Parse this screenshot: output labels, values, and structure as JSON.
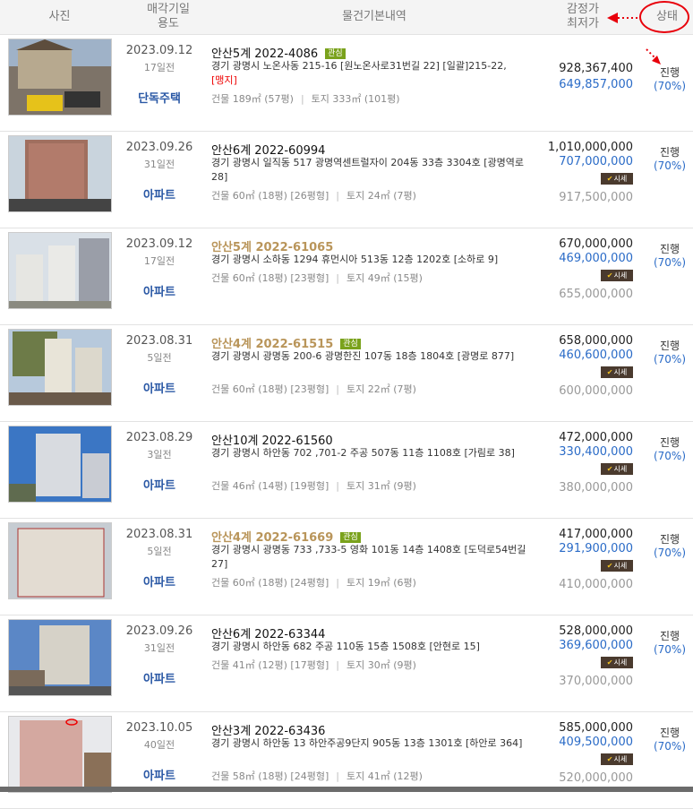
{
  "header": {
    "photo": "사진",
    "date_type_1": "매각기일",
    "date_type_2": "용도",
    "basic": "물건기본내역",
    "price_1": "감정가",
    "price_2": "최저가",
    "status": "상태"
  },
  "colors": {
    "accent": "#e8000b",
    "blue": "#2a6bc7",
    "highlight": "#b9955a"
  },
  "rows": [
    {
      "date": "2023.09.12",
      "ago": "17일전",
      "type": "단독주택",
      "case": "안산5계 2022-4086",
      "tag": "관심",
      "addr": "경기 광명시 노온사동 215-16 [원노온사로31번길 22] [일괄]215-22,",
      "addr_red": "[맹지]",
      "building": "건물 189㎡ (57평)",
      "land": "토지 333㎡ (101평)",
      "appraisal": "928,367,400",
      "minimum": "649,857,000",
      "market_badge": "",
      "market": "",
      "status": "진행",
      "pct": "(70%)"
    },
    {
      "date": "2023.09.26",
      "ago": "31일전",
      "type": "아파트",
      "case": "안산6계 2022-60994",
      "tag": "",
      "addr": "경기 광명시 일직동 517 광명역센트럴자이 204동 33층 3304호 [광명역로 28]",
      "addr_red": "",
      "building": "건물 60㎡ (18평) [26평형]",
      "land": "토지 24㎡ (7평)",
      "appraisal": "1,010,000,000",
      "minimum": "707,000,000",
      "market_badge": "시세",
      "market": "917,500,000",
      "status": "진행",
      "pct": "(70%)"
    },
    {
      "date": "2023.09.12",
      "ago": "17일전",
      "type": "아파트",
      "case": "안산5계 2022-61065",
      "tag": "",
      "addr": "경기 광명시 소하동 1294 휴먼시아 513동 12층 1202호 [소하로 9]",
      "addr_red": "",
      "building": "건물 60㎡ (18평) [23평형]",
      "land": "토지 49㎡ (15평)",
      "appraisal": "670,000,000",
      "minimum": "469,000,000",
      "market_badge": "시세",
      "market": "655,000,000",
      "status": "진행",
      "pct": "(70%)"
    },
    {
      "date": "2023.08.31",
      "ago": "5일전",
      "type": "아파트",
      "case": "안산4계 2022-61515",
      "tag": "관심",
      "addr": "경기 광명시 광명동 200-6 광명한진 107동 18층 1804호 [광명로 877]",
      "addr_red": "",
      "building": "건물 60㎡ (18평) [23평형]",
      "land": "토지 22㎡ (7평)",
      "appraisal": "658,000,000",
      "minimum": "460,600,000",
      "market_badge": "시세",
      "market": "600,000,000",
      "status": "진행",
      "pct": "(70%)"
    },
    {
      "date": "2023.08.29",
      "ago": "3일전",
      "type": "아파트",
      "case": "안산10계 2022-61560",
      "tag": "",
      "addr": "경기 광명시 하안동 702 ,701-2 주공 507동 11층 1108호 [가림로 38]",
      "addr_red": "",
      "building": "건물 46㎡ (14평) [19평형]",
      "land": "토지 31㎡ (9평)",
      "appraisal": "472,000,000",
      "minimum": "330,400,000",
      "market_badge": "시세",
      "market": "380,000,000",
      "status": "진행",
      "pct": "(70%)"
    },
    {
      "date": "2023.08.31",
      "ago": "5일전",
      "type": "아파트",
      "case": "안산4계 2022-61669",
      "tag": "관심",
      "addr": "경기 광명시 광명동 733 ,733-5 영화 101동 14층 1408호 [도덕로54번길 27]",
      "addr_red": "",
      "building": "건물 60㎡ (18평) [24평형]",
      "land": "토지 19㎡ (6평)",
      "appraisal": "417,000,000",
      "minimum": "291,900,000",
      "market_badge": "시세",
      "market": "410,000,000",
      "status": "진행",
      "pct": "(70%)"
    },
    {
      "date": "2023.09.26",
      "ago": "31일전",
      "type": "아파트",
      "case": "안산6계 2022-63344",
      "tag": "",
      "addr": "경기 광명시 하안동 682 주공 110동 15층 1508호 [안현로 15]",
      "addr_red": "",
      "building": "건물 41㎡ (12평) [17평형]",
      "land": "토지 30㎡ (9평)",
      "appraisal": "528,000,000",
      "minimum": "369,600,000",
      "market_badge": "시세",
      "market": "370,000,000",
      "status": "진행",
      "pct": "(70%)"
    },
    {
      "date": "2023.10.05",
      "ago": "40일전",
      "type": "아파트",
      "case": "안산3계 2022-63436",
      "tag": "",
      "addr": "경기 광명시 하안동 13 하안주공9단지 905동 13층 1301호 [하안로 364]",
      "addr_red": "",
      "building": "건물 58㎡ (18평) [24평형]",
      "land": "토지 41㎡ (12평)",
      "appraisal": "585,000,000",
      "minimum": "409,500,000",
      "market_badge": "시세",
      "market": "520,000,000",
      "status": "진행",
      "pct": "(70%)"
    }
  ]
}
